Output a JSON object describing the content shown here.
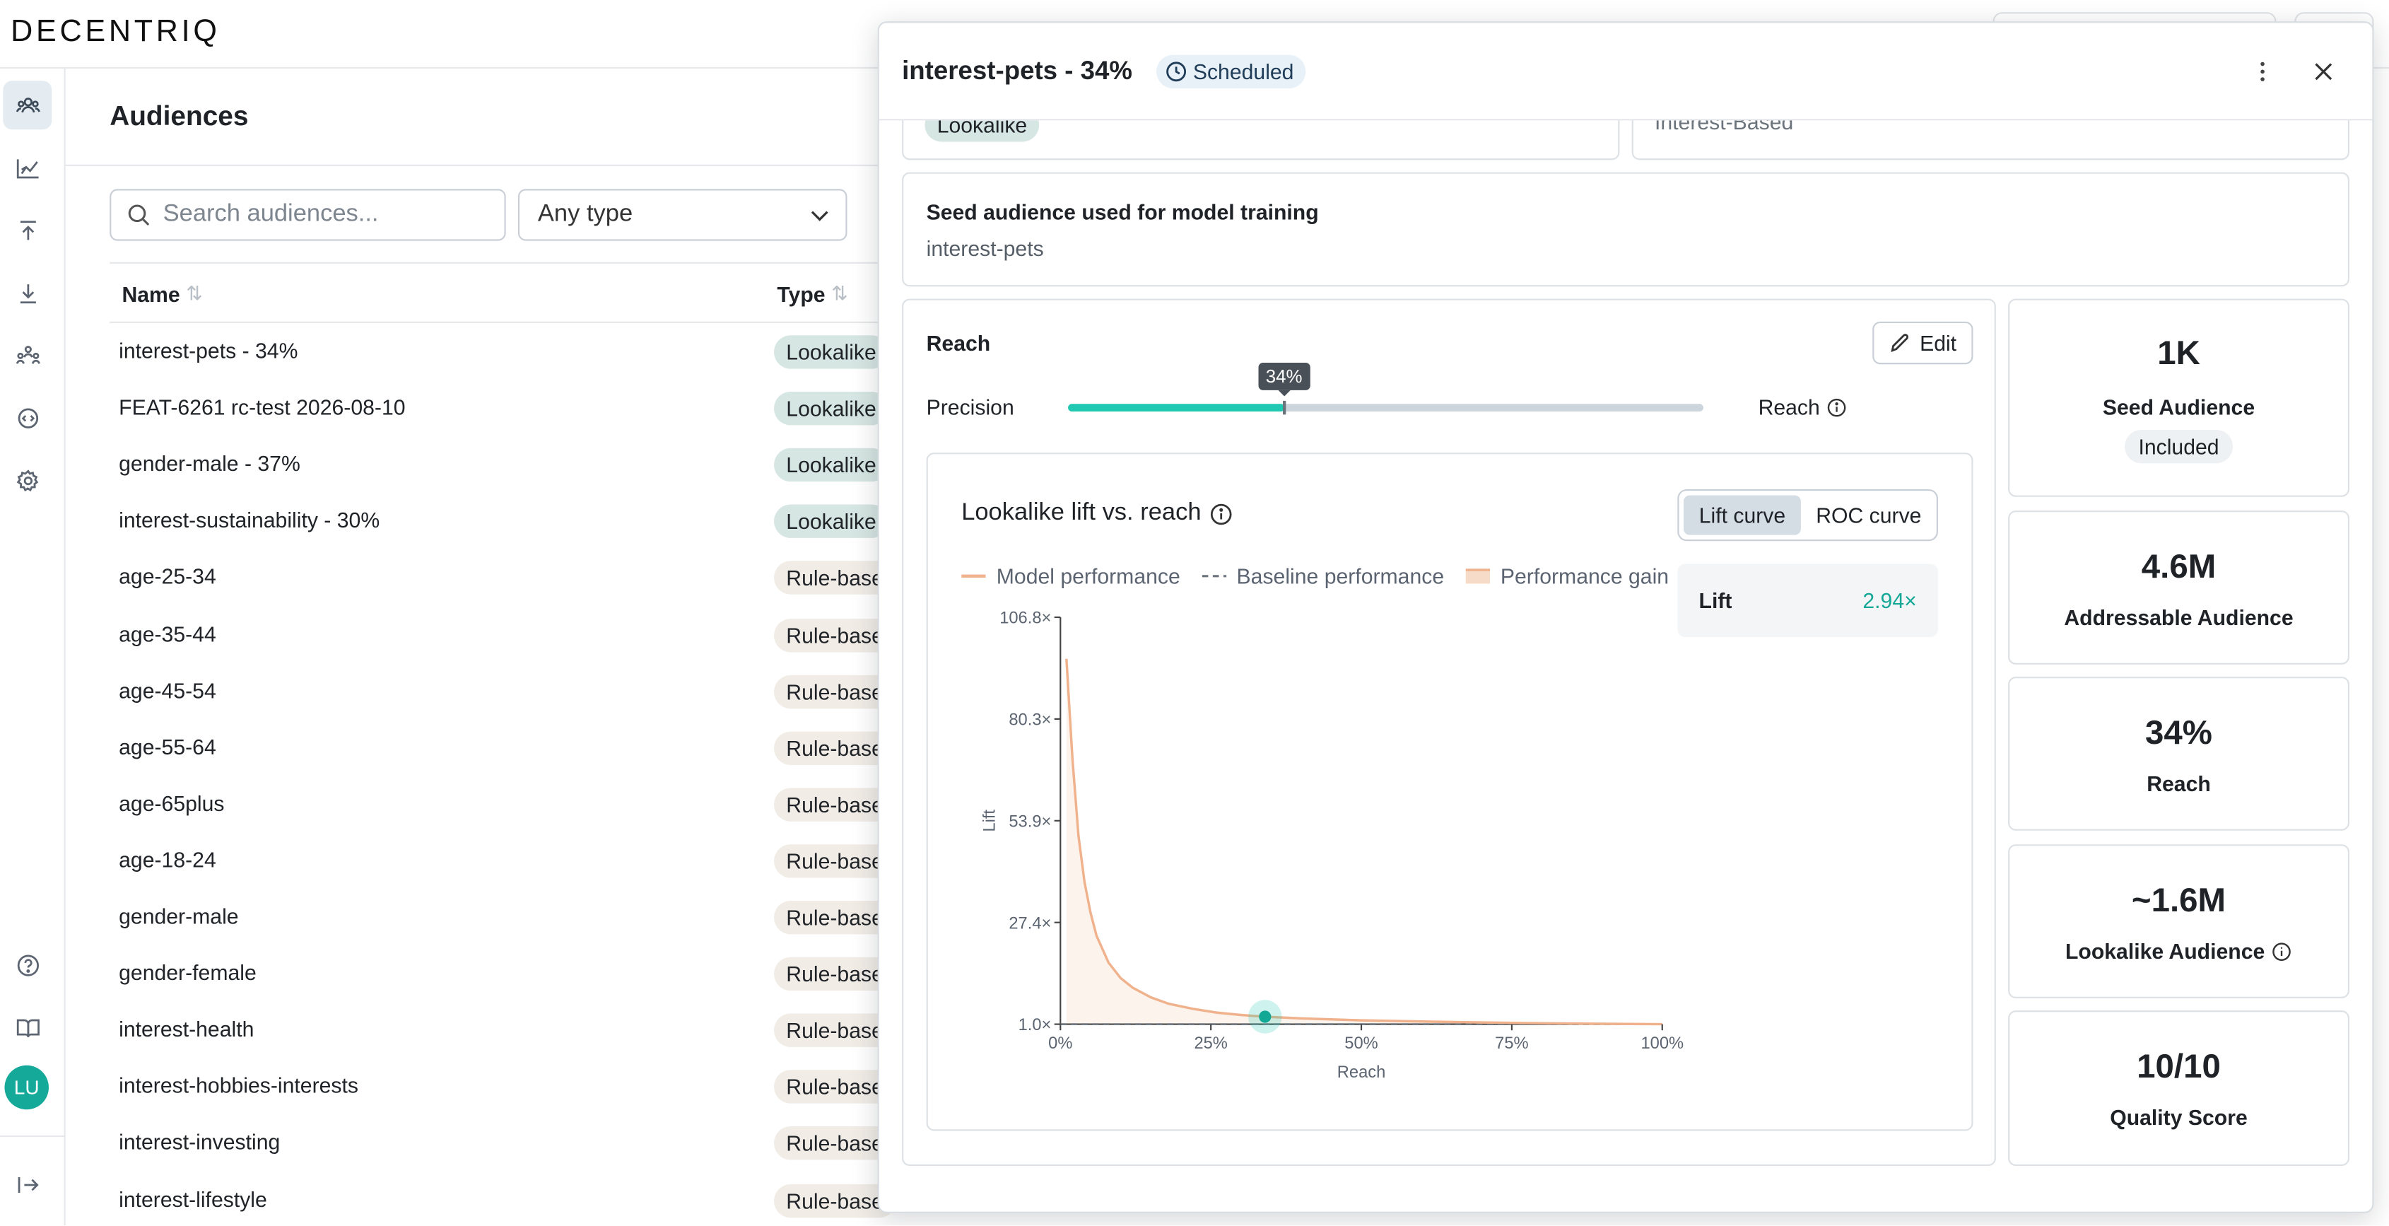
{
  "app": {
    "logo": "DECENTRIQ",
    "user_initials": "LU"
  },
  "page": {
    "title": "Audiences"
  },
  "filters": {
    "search_placeholder": "Search audiences...",
    "type_value": "Any type"
  },
  "table": {
    "columns": [
      "Name",
      "Type"
    ],
    "rows": [
      {
        "name": "interest-pets - 34%",
        "type": "Lookalike"
      },
      {
        "name": "FEAT-6261 rc-test 2026-08-10",
        "type": "Lookalike"
      },
      {
        "name": "gender-male - 37%",
        "type": "Lookalike"
      },
      {
        "name": "interest-sustainability - 30%",
        "type": "Lookalike"
      },
      {
        "name": "age-25-34",
        "type": "Rule-base"
      },
      {
        "name": "age-35-44",
        "type": "Rule-base"
      },
      {
        "name": "age-45-54",
        "type": "Rule-base"
      },
      {
        "name": "age-55-64",
        "type": "Rule-base"
      },
      {
        "name": "age-65plus",
        "type": "Rule-base"
      },
      {
        "name": "age-18-24",
        "type": "Rule-base"
      },
      {
        "name": "gender-male",
        "type": "Rule-base"
      },
      {
        "name": "gender-female",
        "type": "Rule-base"
      },
      {
        "name": "interest-health",
        "type": "Rule-base"
      },
      {
        "name": "interest-hobbies-interests",
        "type": "Rule-base"
      },
      {
        "name": "interest-investing",
        "type": "Rule-base"
      },
      {
        "name": "interest-lifestyle",
        "type": "Rule-base"
      }
    ]
  },
  "drawer": {
    "title": "interest-pets - 34%",
    "status": "Scheduled",
    "partial_badge": "Lookalike",
    "partial_text": "Interest-Based",
    "seed": {
      "label": "Seed audience used for model training",
      "value": "interest-pets"
    },
    "reach": {
      "label": "Reach",
      "edit_label": "Edit",
      "left_label": "Precision",
      "right_label": "Reach",
      "value_label": "34%",
      "value": 0.34
    },
    "chart": {
      "title": "Lookalike lift vs. reach",
      "tabs": [
        "Lift curve",
        "ROC curve"
      ],
      "active_tab": "Lift curve",
      "legend": [
        "Model performance",
        "Baseline performance",
        "Performance gain"
      ],
      "lift_label": "Lift",
      "lift_value": "2.94×"
    },
    "stats": [
      {
        "value": "1K",
        "label": "Seed Audience",
        "pill": "Included"
      },
      {
        "value": "4.6M",
        "label": "Addressable Audience"
      },
      {
        "value": "34%",
        "label": "Reach"
      },
      {
        "value": "~1.6M",
        "label": "Lookalike Audience",
        "info": true
      },
      {
        "value": "10/10",
        "label": "Quality Score"
      }
    ]
  },
  "chart_data": {
    "type": "line",
    "title": "Lookalike lift vs. reach",
    "xlabel": "Reach",
    "ylabel": "Lift",
    "x_ticks": [
      "0%",
      "25%",
      "50%",
      "75%",
      "100%"
    ],
    "y_ticks": [
      "1.0×",
      "27.4×",
      "53.9×",
      "80.3×",
      "106.8×"
    ],
    "xlim": [
      0,
      1
    ],
    "ylim": [
      1.0,
      106.8
    ],
    "grid": false,
    "legend_position": "top-left",
    "series": [
      {
        "name": "Model performance",
        "color": "#f0b28c",
        "x": [
          0.01,
          0.02,
          0.03,
          0.04,
          0.05,
          0.06,
          0.08,
          0.1,
          0.12,
          0.15,
          0.18,
          0.22,
          0.26,
          0.3,
          0.34,
          0.4,
          0.5,
          0.6,
          0.7,
          0.8,
          0.9,
          1.0
        ],
        "y": [
          96.0,
          70.0,
          50.0,
          38.0,
          30.0,
          24.0,
          17.0,
          13.0,
          10.5,
          8.0,
          6.3,
          5.0,
          4.0,
          3.4,
          2.94,
          2.5,
          2.0,
          1.7,
          1.45,
          1.25,
          1.1,
          1.0
        ]
      },
      {
        "name": "Baseline performance",
        "color": "#6b737c",
        "x": [
          0,
          1
        ],
        "y": [
          1.0,
          1.0
        ]
      }
    ],
    "highlight_point": {
      "x": 0.34,
      "y": 2.94
    },
    "colors": {
      "accent": "#1fc9b2",
      "gain_fill": "#f6dcc8"
    }
  }
}
